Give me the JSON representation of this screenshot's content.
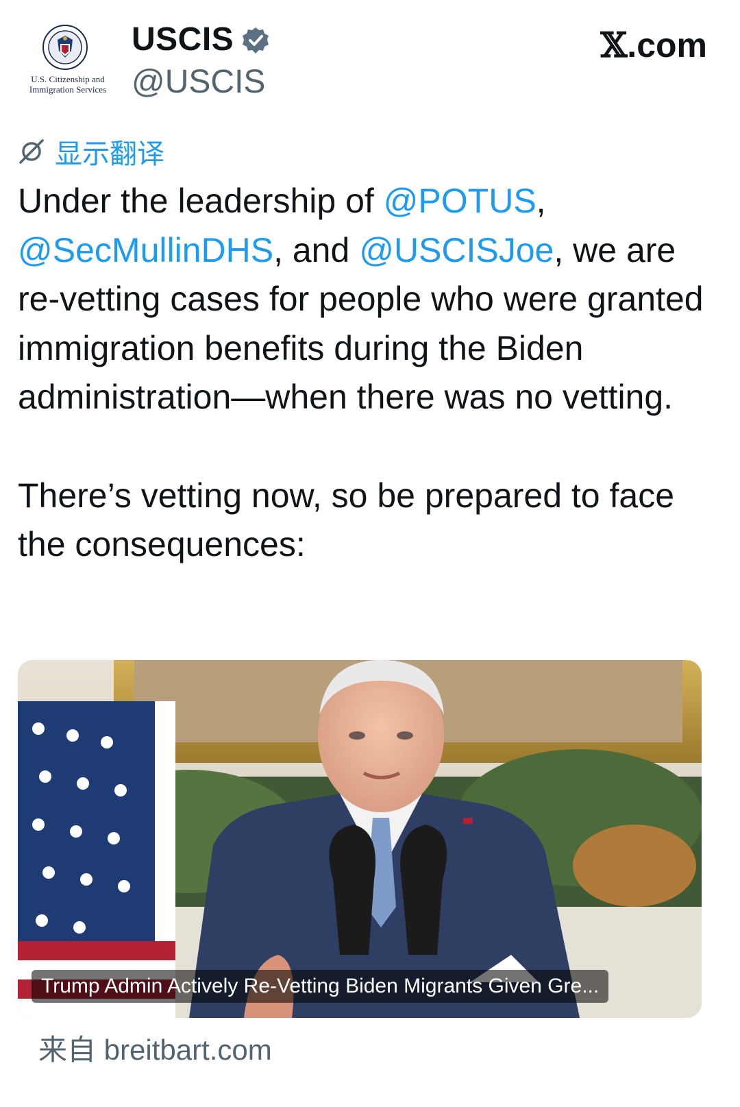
{
  "header": {
    "logo_text_line1": "U.S. Citizenship and",
    "logo_text_line2": "Immigration Services",
    "author_name": "USCIS",
    "handle": "@USCIS",
    "site_x": "𝕏",
    "site_rest": ".com"
  },
  "translate": {
    "label": "显示翻译"
  },
  "tweet": {
    "p1": [
      {
        "text": "Under the leadership of "
      },
      {
        "text": "@POTUS",
        "mention": true
      },
      {
        "text": ", "
      },
      {
        "text": "@SecMullinDHS",
        "mention": true
      },
      {
        "text": ", and "
      },
      {
        "text": "@USCISJoe",
        "mention": true
      },
      {
        "text": ", we are re-vetting cases for people who were granted immigration benefits during the Biden administration—when there was no vetting."
      }
    ],
    "p2": "There’s vetting now, so be prepared to face the consequences:"
  },
  "card": {
    "title": "Trump Admin Actively Re-Vetting Biden Migrants Given Gre..."
  },
  "source": "来自 breitbart.com",
  "colors": {
    "link": "#1d9bf0",
    "muted": "#536471",
    "text": "#0f1419"
  }
}
